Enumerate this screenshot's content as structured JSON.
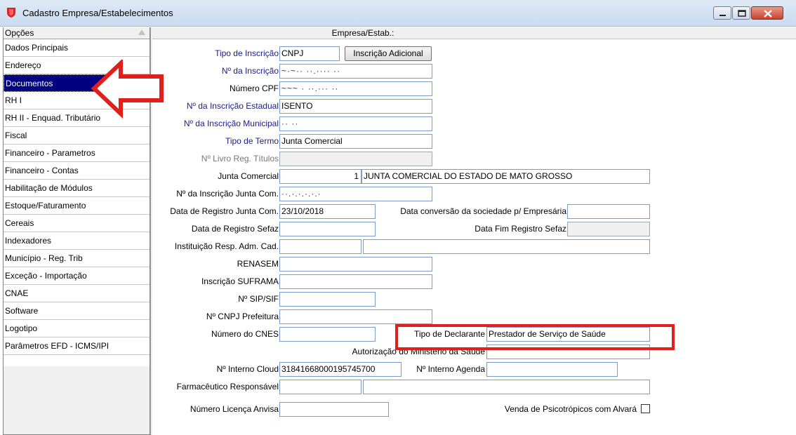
{
  "window": {
    "title": "Cadastro Empresa/Estabelecimentos"
  },
  "sidebar": {
    "header": "Opções",
    "items": [
      {
        "label": "Dados Principais"
      },
      {
        "label": "Endereço"
      },
      {
        "label": "Documentos",
        "selected": true
      },
      {
        "label": "RH I"
      },
      {
        "label": "RH II - Enquad. Tributário"
      },
      {
        "label": "Fiscal"
      },
      {
        "label": "Financeiro - Parametros"
      },
      {
        "label": "Financeiro - Contas"
      },
      {
        "label": "Habilitação de Módulos"
      },
      {
        "label": "Estoque/Faturamento"
      },
      {
        "label": "Cereais"
      },
      {
        "label": "Indexadores"
      },
      {
        "label": "Município - Reg. Trib"
      },
      {
        "label": "Exceção - Importação"
      },
      {
        "label": "CNAE"
      },
      {
        "label": "Software"
      },
      {
        "label": "Logotipo"
      },
      {
        "label": "Parâmetros EFD - ICMS/IPI"
      }
    ]
  },
  "content": {
    "header": "Empresa/Estab.:"
  },
  "form": {
    "tipo_inscricao": {
      "label": "Tipo de Inscrição",
      "value": "CNPJ"
    },
    "inscricao_adicional_button": "Inscrição Adicional",
    "num_inscricao": {
      "label": "Nº da Inscrição",
      "value": "~·~·· ··.···· ··"
    },
    "numero_cpf": {
      "label": "Número CPF",
      "value": "~~~ ·  ··.··· ··"
    },
    "inscricao_estadual": {
      "label": "Nº da Inscrição Estadual",
      "value": "ISENTO"
    },
    "inscricao_municipal": {
      "label": "Nº da Inscrição Municipal",
      "value": "·· ··"
    },
    "tipo_termo": {
      "label": "Tipo de Termo",
      "value": "Junta Comercial"
    },
    "livro_reg_titulos": {
      "label": "Nº Livro Reg. Títulos",
      "value": ""
    },
    "junta_comercial": {
      "label": "Junta Comercial",
      "code": "1",
      "name": "JUNTA COMERCIAL DO ESTADO DE MATO GROSSO"
    },
    "inscricao_junta": {
      "label": "Nº da Inscrição Junta Com.",
      "value": "··.·.·.·.·.·"
    },
    "data_registro_junta": {
      "label": "Data de Registro Junta Com.",
      "value": "23/10/2018"
    },
    "data_conversao": {
      "label": "Data conversão da sociedade p/ Empresária",
      "value": ""
    },
    "data_registro_sefaz": {
      "label": "Data de Registro Sefaz",
      "value": ""
    },
    "data_fim_sefaz": {
      "label": "Data Fim Registro Sefaz",
      "value": ""
    },
    "instituicao_resp": {
      "label": "Instituição Resp. Adm. Cad.",
      "code": "",
      "name": ""
    },
    "renasem": {
      "label": "RENASEM",
      "value": ""
    },
    "suframa": {
      "label": "Inscrição SUFRAMA",
      "value": ""
    },
    "sip_sif": {
      "label": "Nº SIP/SIF",
      "value": ""
    },
    "cnpj_prefeitura": {
      "label": "Nº  CNPJ Prefeitura",
      "value": ""
    },
    "numero_cnes": {
      "label": "Número do CNES",
      "value": ""
    },
    "tipo_declarante": {
      "label": "Tipo de Declarante",
      "value": "Prestador de Serviço de Saúde"
    },
    "autorizacao_ministerio": {
      "label": "Autorização do Ministério da Saúde",
      "value": ""
    },
    "interno_cloud": {
      "label": "Nº Interno Cloud",
      "value": "31841668000195745700"
    },
    "interno_agenda": {
      "label": "Nº Interno Agenda",
      "value": ""
    },
    "farmaceutico": {
      "label": "Farmacêutico Responsável",
      "code": "",
      "name": ""
    },
    "licenca_anvisa": {
      "label": "Número Licença Anvisa",
      "value": ""
    },
    "venda_psicotropicos": {
      "label": "Venda de Psicotrópicos com Alvará",
      "checked": false
    }
  },
  "annotations": {
    "arrow_color": "#e0201c",
    "highlight_color": "#e0201c"
  }
}
